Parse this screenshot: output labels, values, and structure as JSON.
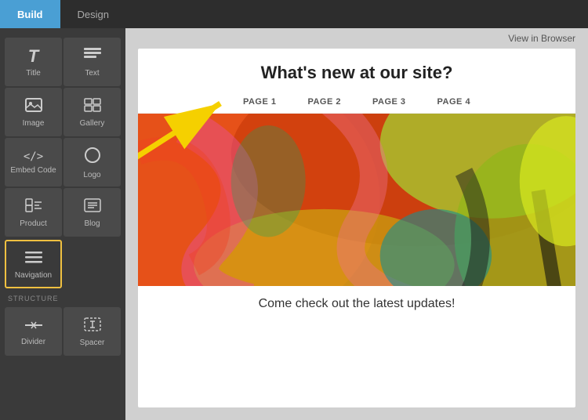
{
  "tabs": {
    "build": "Build",
    "design": "Design"
  },
  "header": {
    "view_in_browser": "View in Browser"
  },
  "sidebar": {
    "items": [
      {
        "id": "title",
        "label": "Title",
        "icon": "T"
      },
      {
        "id": "text",
        "label": "Text",
        "icon": "≡"
      },
      {
        "id": "image",
        "label": "Image",
        "icon": "img"
      },
      {
        "id": "gallery",
        "label": "Gallery",
        "icon": "gallery"
      },
      {
        "id": "embed-code",
        "label": "Embed Code",
        "icon": "</>"
      },
      {
        "id": "logo",
        "label": "Logo",
        "icon": "○"
      },
      {
        "id": "product",
        "label": "Product",
        "icon": "product"
      },
      {
        "id": "blog",
        "label": "Blog",
        "icon": "blog"
      },
      {
        "id": "navigation",
        "label": "Navigation",
        "icon": "nav",
        "highlighted": true
      }
    ],
    "structure_label": "STRUCTURE",
    "structure_items": [
      {
        "id": "divider",
        "label": "Divider",
        "icon": "divider"
      },
      {
        "id": "spacer",
        "label": "Spacer",
        "icon": "spacer"
      }
    ]
  },
  "page": {
    "title": "What's new at our site?",
    "nav_items": [
      "PAGE 1",
      "PAGE 2",
      "PAGE 3",
      "PAGE 4"
    ],
    "bottom_text": "Come check out the latest updates!"
  }
}
